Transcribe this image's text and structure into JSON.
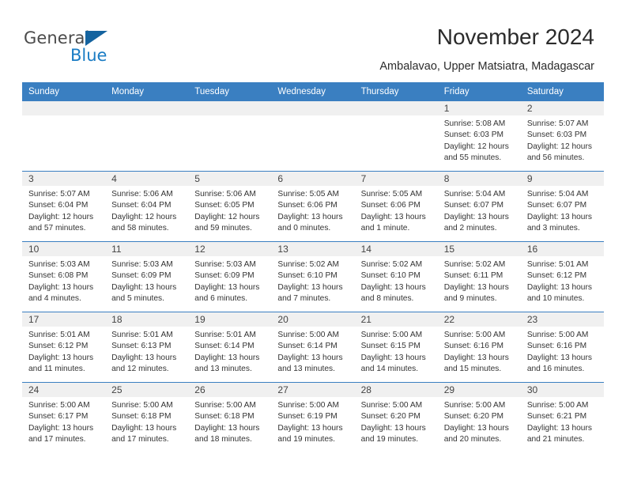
{
  "brand": {
    "name_part1": "General",
    "name_part2": "Blue",
    "accent_color": "#1a7cc4",
    "triangle_color": "#14639f"
  },
  "header": {
    "month_title": "November 2024",
    "location": "Ambalavao, Upper Matsiatra, Madagascar"
  },
  "calendar": {
    "header_bg": "#3a7fc1",
    "weekday_headers": [
      "Sunday",
      "Monday",
      "Tuesday",
      "Wednesday",
      "Thursday",
      "Friday",
      "Saturday"
    ],
    "weeks": [
      [
        {
          "day": "",
          "info": ""
        },
        {
          "day": "",
          "info": ""
        },
        {
          "day": "",
          "info": ""
        },
        {
          "day": "",
          "info": ""
        },
        {
          "day": "",
          "info": ""
        },
        {
          "day": "1",
          "info": "Sunrise: 5:08 AM\nSunset: 6:03 PM\nDaylight: 12 hours and 55 minutes."
        },
        {
          "day": "2",
          "info": "Sunrise: 5:07 AM\nSunset: 6:03 PM\nDaylight: 12 hours and 56 minutes."
        }
      ],
      [
        {
          "day": "3",
          "info": "Sunrise: 5:07 AM\nSunset: 6:04 PM\nDaylight: 12 hours and 57 minutes."
        },
        {
          "day": "4",
          "info": "Sunrise: 5:06 AM\nSunset: 6:04 PM\nDaylight: 12 hours and 58 minutes."
        },
        {
          "day": "5",
          "info": "Sunrise: 5:06 AM\nSunset: 6:05 PM\nDaylight: 12 hours and 59 minutes."
        },
        {
          "day": "6",
          "info": "Sunrise: 5:05 AM\nSunset: 6:06 PM\nDaylight: 13 hours and 0 minutes."
        },
        {
          "day": "7",
          "info": "Sunrise: 5:05 AM\nSunset: 6:06 PM\nDaylight: 13 hours and 1 minute."
        },
        {
          "day": "8",
          "info": "Sunrise: 5:04 AM\nSunset: 6:07 PM\nDaylight: 13 hours and 2 minutes."
        },
        {
          "day": "9",
          "info": "Sunrise: 5:04 AM\nSunset: 6:07 PM\nDaylight: 13 hours and 3 minutes."
        }
      ],
      [
        {
          "day": "10",
          "info": "Sunrise: 5:03 AM\nSunset: 6:08 PM\nDaylight: 13 hours and 4 minutes."
        },
        {
          "day": "11",
          "info": "Sunrise: 5:03 AM\nSunset: 6:09 PM\nDaylight: 13 hours and 5 minutes."
        },
        {
          "day": "12",
          "info": "Sunrise: 5:03 AM\nSunset: 6:09 PM\nDaylight: 13 hours and 6 minutes."
        },
        {
          "day": "13",
          "info": "Sunrise: 5:02 AM\nSunset: 6:10 PM\nDaylight: 13 hours and 7 minutes."
        },
        {
          "day": "14",
          "info": "Sunrise: 5:02 AM\nSunset: 6:10 PM\nDaylight: 13 hours and 8 minutes."
        },
        {
          "day": "15",
          "info": "Sunrise: 5:02 AM\nSunset: 6:11 PM\nDaylight: 13 hours and 9 minutes."
        },
        {
          "day": "16",
          "info": "Sunrise: 5:01 AM\nSunset: 6:12 PM\nDaylight: 13 hours and 10 minutes."
        }
      ],
      [
        {
          "day": "17",
          "info": "Sunrise: 5:01 AM\nSunset: 6:12 PM\nDaylight: 13 hours and 11 minutes."
        },
        {
          "day": "18",
          "info": "Sunrise: 5:01 AM\nSunset: 6:13 PM\nDaylight: 13 hours and 12 minutes."
        },
        {
          "day": "19",
          "info": "Sunrise: 5:01 AM\nSunset: 6:14 PM\nDaylight: 13 hours and 13 minutes."
        },
        {
          "day": "20",
          "info": "Sunrise: 5:00 AM\nSunset: 6:14 PM\nDaylight: 13 hours and 13 minutes."
        },
        {
          "day": "21",
          "info": "Sunrise: 5:00 AM\nSunset: 6:15 PM\nDaylight: 13 hours and 14 minutes."
        },
        {
          "day": "22",
          "info": "Sunrise: 5:00 AM\nSunset: 6:16 PM\nDaylight: 13 hours and 15 minutes."
        },
        {
          "day": "23",
          "info": "Sunrise: 5:00 AM\nSunset: 6:16 PM\nDaylight: 13 hours and 16 minutes."
        }
      ],
      [
        {
          "day": "24",
          "info": "Sunrise: 5:00 AM\nSunset: 6:17 PM\nDaylight: 13 hours and 17 minutes."
        },
        {
          "day": "25",
          "info": "Sunrise: 5:00 AM\nSunset: 6:18 PM\nDaylight: 13 hours and 17 minutes."
        },
        {
          "day": "26",
          "info": "Sunrise: 5:00 AM\nSunset: 6:18 PM\nDaylight: 13 hours and 18 minutes."
        },
        {
          "day": "27",
          "info": "Sunrise: 5:00 AM\nSunset: 6:19 PM\nDaylight: 13 hours and 19 minutes."
        },
        {
          "day": "28",
          "info": "Sunrise: 5:00 AM\nSunset: 6:20 PM\nDaylight: 13 hours and 19 minutes."
        },
        {
          "day": "29",
          "info": "Sunrise: 5:00 AM\nSunset: 6:20 PM\nDaylight: 13 hours and 20 minutes."
        },
        {
          "day": "30",
          "info": "Sunrise: 5:00 AM\nSunset: 6:21 PM\nDaylight: 13 hours and 21 minutes."
        }
      ]
    ]
  }
}
